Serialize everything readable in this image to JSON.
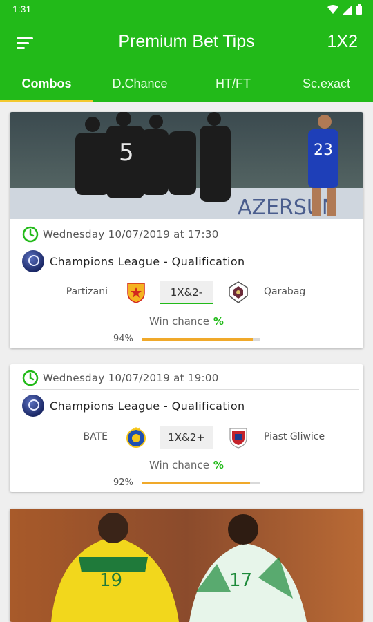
{
  "status_bar": {
    "time": "1:31"
  },
  "app_bar": {
    "title": "Premium Bet Tips",
    "action_label": "1X2"
  },
  "tabs": [
    {
      "label": "Combos",
      "active": true
    },
    {
      "label": "D.Chance",
      "active": false
    },
    {
      "label": "HT/FT",
      "active": false
    },
    {
      "label": "Sc.exact",
      "active": false
    }
  ],
  "matches": [
    {
      "date": "Wednesday 10/07/2019 at 17:30",
      "league": "Champions League - Qualification",
      "home_team": "Partizani",
      "away_team": "Qarabag",
      "tip": "1X&2-",
      "win_chance_label": "Win chance",
      "win_chance_symbol": "%",
      "probability": "94%",
      "probability_value": 94
    },
    {
      "date": "Wednesday 10/07/2019 at 19:00",
      "league": "Champions League - Qualification",
      "home_team": "BATE",
      "away_team": "Piast Gliwice",
      "tip": "1X&2+",
      "win_chance_label": "Win chance",
      "win_chance_symbol": "%",
      "probability": "92%",
      "probability_value": 92
    }
  ],
  "colors": {
    "brand_green": "#22ba19",
    "accent_yellow": "#f3c92f",
    "bar_orange": "#f0a92a"
  }
}
